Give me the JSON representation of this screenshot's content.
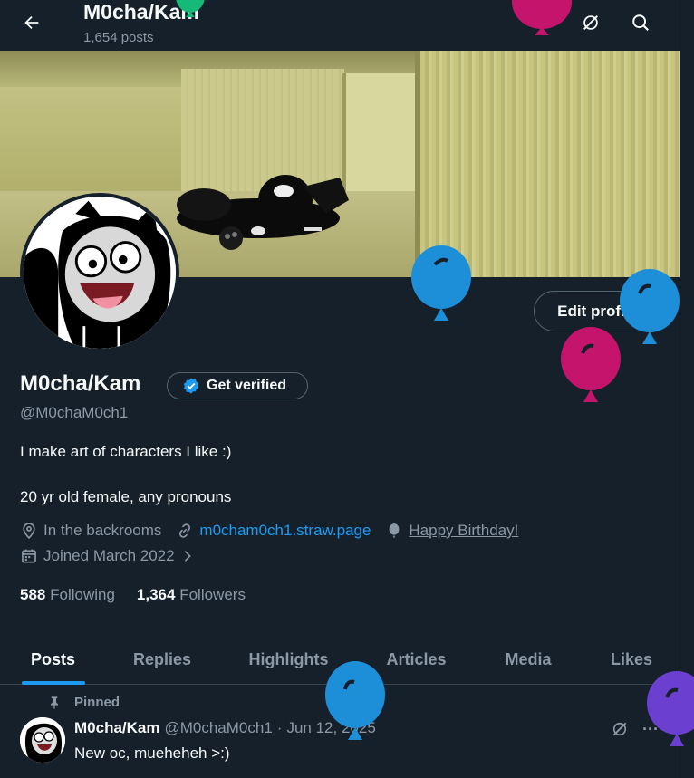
{
  "header": {
    "title": "M0cha/Kam",
    "post_count": "1,654 posts"
  },
  "profile": {
    "display_name": "M0cha/Kam",
    "verify_label": "Get verified",
    "handle": "@M0chaM0ch1",
    "edit_label": "Edit profile",
    "bio_lines": [
      "I make art of characters I like :)",
      "20 yr old female, any pronouns"
    ],
    "location": "In the backrooms",
    "website": "m0cham0ch1.straw.page",
    "birthday": "Happy Birthday!",
    "joined": "Joined March 2022",
    "following_count": "588",
    "following_label": "Following",
    "followers_count": "1,364",
    "followers_label": "Followers"
  },
  "tabs": [
    {
      "label": "Posts",
      "active": true
    },
    {
      "label": "Replies",
      "active": false
    },
    {
      "label": "Highlights",
      "active": false
    },
    {
      "label": "Articles",
      "active": false
    },
    {
      "label": "Media",
      "active": false
    },
    {
      "label": "Likes",
      "active": false
    }
  ],
  "pinned_post": {
    "pinned_label": "Pinned",
    "author": "M0cha/Kam",
    "handle": "@M0chaM0ch1",
    "separator": "·",
    "date": "Jun 12, 2025",
    "text": "New oc, mueheheh >:)",
    "more_label": "···"
  },
  "colors": {
    "background": "#15202b",
    "accent": "#1d9bf0",
    "muted": "#8b98a5",
    "balloon_blue": "#1d8fd9",
    "balloon_pink": "#c5146b",
    "balloon_purple": "#6b3fd0",
    "balloon_green": "#17b978"
  },
  "icons": [
    "back-arrow-icon",
    "grok-icon",
    "search-icon",
    "verified-badge-icon",
    "location-icon",
    "link-icon",
    "balloon-icon",
    "calendar-icon",
    "chevron-right-icon",
    "pin-icon",
    "more-icon"
  ]
}
